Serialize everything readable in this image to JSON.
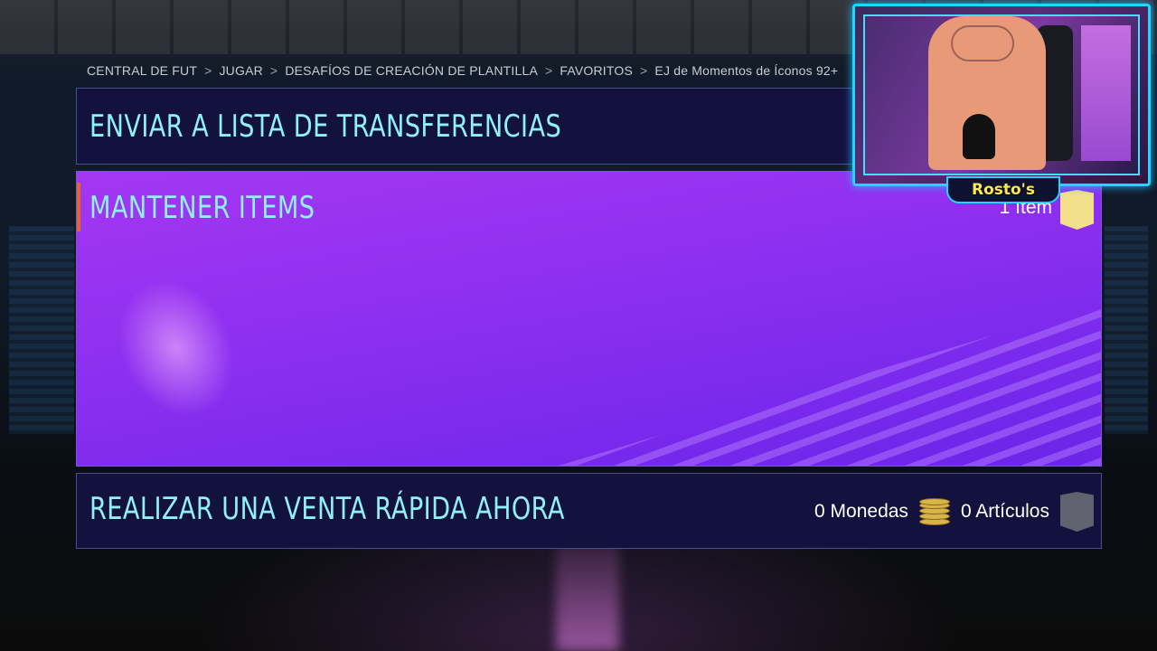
{
  "breadcrumb": {
    "items": [
      "CENTRAL DE FUT",
      "JUGAR",
      "DESAFÍOS DE CREACIÓN DE PLANTILLA",
      "FAVORITOS",
      "EJ de Momentos de Íconos 92+"
    ],
    "separator": ">"
  },
  "panels": {
    "send": {
      "title": "ENVIAR A LISTA DE TRANSFERENCIAS"
    },
    "keep": {
      "title": "MANTENER ITEMS",
      "count": "1 Ítem",
      "card_icon": "gold-card-icon"
    },
    "sell": {
      "title": "REALIZAR UNA VENTA RÁPIDA AHORA",
      "coins": "0 Monedas",
      "articles": "0 Artículos",
      "coin_icon": "coins-icon",
      "card_icon": "grey-card-icon"
    }
  },
  "webcam": {
    "name": "Rosto's"
  },
  "colors": {
    "title_cyan": "#8ff0f5",
    "panel_navy": "#13123f",
    "keep_purple": "#8c2ff0",
    "accent_orange": "#e2652a",
    "webcam_border": "#20d6ff",
    "name_yellow": "#ffe94a"
  }
}
